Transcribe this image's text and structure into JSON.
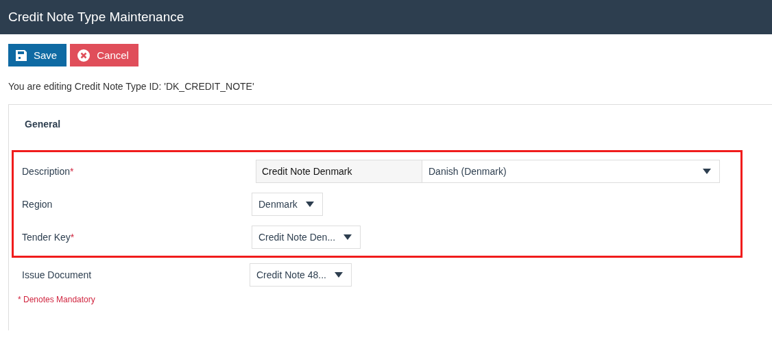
{
  "window": {
    "title": "Credit Note Type Maintenance"
  },
  "toolbar": [
    {
      "kind": "save",
      "label": "Save"
    },
    {
      "kind": "cancel",
      "label": "Cancel"
    }
  ],
  "editing_text": "You are editing Credit Note Type ID: 'DK_CREDIT_NOTE'",
  "section": {
    "title": "General",
    "rows": [
      {
        "kind": "translated",
        "label": "Description",
        "required_mark": "*",
        "highlighted": true,
        "value": "Credit Note Denmark",
        "language": "Danish (Denmark)"
      },
      {
        "kind": "select",
        "label": "Region",
        "highlighted": true,
        "value": "Denmark"
      },
      {
        "kind": "select",
        "label": "Tender Key",
        "required_mark": "*",
        "highlighted": true,
        "value": "Credit Note Den..."
      },
      {
        "kind": "select",
        "label": "Issue Document",
        "highlighted": false,
        "value": "Credit Note 48..."
      }
    ],
    "mandatory_note": "* Denotes Mandatory"
  }
}
